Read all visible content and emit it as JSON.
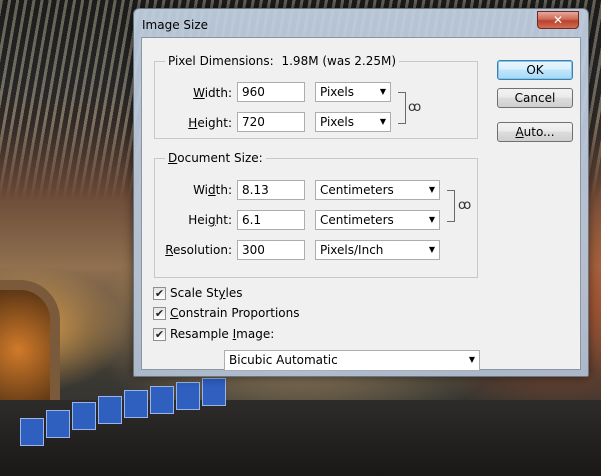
{
  "window": {
    "title": "Image Size",
    "close_glyph": "✕"
  },
  "pixel_dimensions": {
    "label": "Pixel Dimensions:",
    "size_info": "1.98M (was 2.25M)",
    "width": {
      "label_prefix": "",
      "label_key": "W",
      "label_rest": "idth:",
      "value": "960",
      "unit": "Pixels"
    },
    "height": {
      "label_prefix": "",
      "label_key": "H",
      "label_rest": "eight:",
      "value": "720",
      "unit": "Pixels"
    }
  },
  "document_size": {
    "label_key": "D",
    "label_rest": "ocument Size:",
    "width": {
      "label_prefix": "Wi",
      "label_key": "d",
      "label_rest": "th:",
      "value": "8.13",
      "unit": "Centimeters"
    },
    "height": {
      "label_prefix": "Hei",
      "label_key": "g",
      "label_rest": "ht:",
      "value": "6.1",
      "unit": "Centimeters"
    },
    "resolution": {
      "label_prefix": "",
      "label_key": "R",
      "label_rest": "esolution:",
      "value": "300",
      "unit": "Pixels/Inch"
    }
  },
  "buttons": {
    "ok": "OK",
    "cancel": "Cancel",
    "auto_key": "A",
    "auto_rest": "uto..."
  },
  "options": {
    "scale_styles": {
      "prefix": "Scale St",
      "key": "y",
      "rest": "les",
      "checked": true
    },
    "constrain": {
      "prefix": "",
      "key": "C",
      "rest": "onstrain Proportions",
      "checked": true
    },
    "resample": {
      "prefix": "Resample ",
      "key": "I",
      "rest": "mage:",
      "checked": true
    },
    "check_glyph": "✔",
    "resample_method": "Bicubic Automatic"
  },
  "icons": {
    "dropdown_arrow": "▼",
    "link_chain": "ꝏ"
  }
}
